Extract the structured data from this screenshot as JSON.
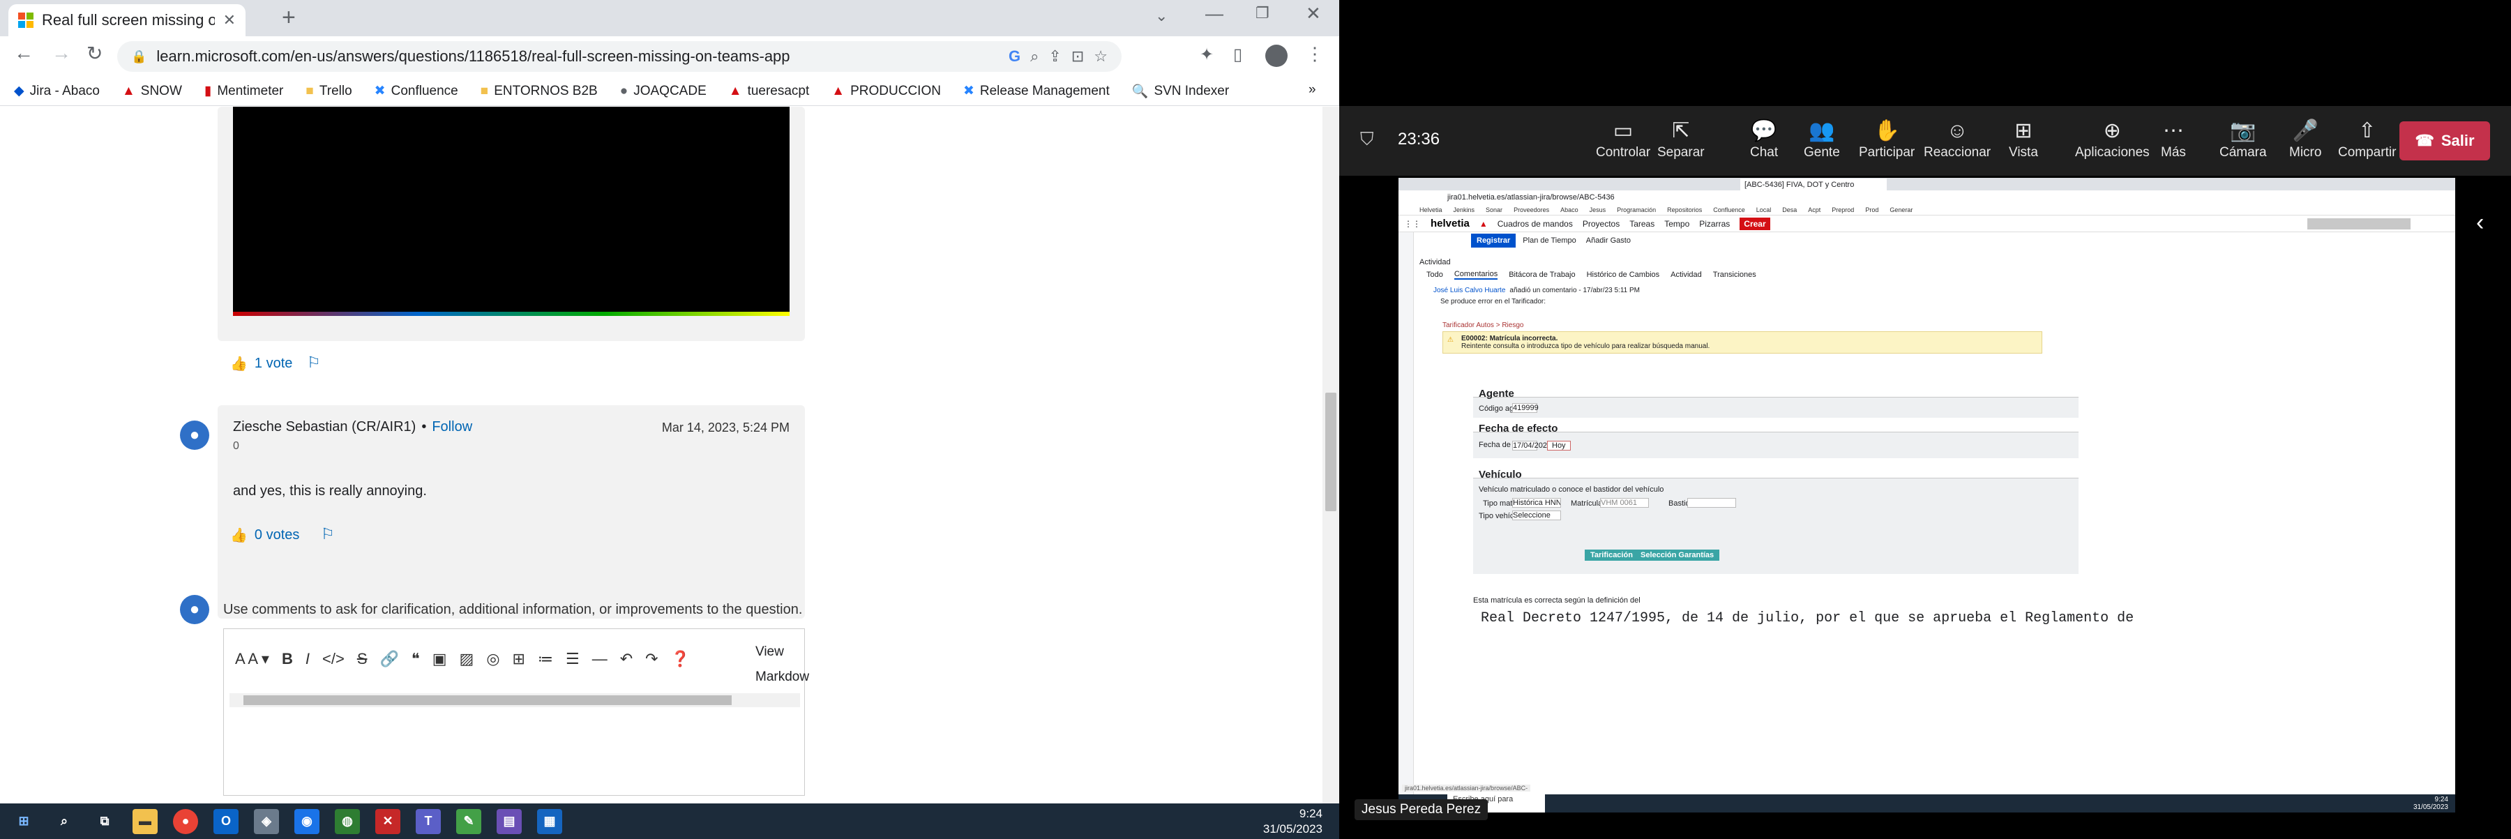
{
  "browser": {
    "tab_title": "Real full screen missing on Teams",
    "url": "learn.microsoft.com/en-us/answers/questions/1186518/real-full-screen-missing-on-teams-app",
    "bookmarks": [
      "Jira - Abaco",
      "SNOW",
      "Mentimeter",
      "Trello",
      "Confluence",
      "ENTORNOS B2B",
      "JOAQCADE",
      "tueresacpt",
      "PRODUCCION",
      "Release Management",
      "SVN Indexer"
    ],
    "more": "»"
  },
  "answer1": {
    "votes": "1 vote"
  },
  "comment": {
    "author": "Ziesche Sebastian (CR/AIR1)",
    "separator": "•",
    "follow": "Follow",
    "rep": "0",
    "date": "Mar 14, 2023, 5:24 PM",
    "text": "and yes, this is really annoying.",
    "votes": "0 votes"
  },
  "comment_box": {
    "prompt": "Use comments to ask for clarification, additional information, or improvements to the question.",
    "view": "View",
    "markdown": "Markdow"
  },
  "taskbar": {
    "time": "9:24",
    "date": "31/05/2023"
  },
  "teams": {
    "timer": "23:36",
    "buttons": [
      "Controlar",
      "Separar",
      "Chat",
      "Gente",
      "Participar",
      "Reaccionar",
      "Vista",
      "Aplicaciones",
      "Más",
      "Cámara",
      "Micro",
      "Compartir"
    ],
    "leave": "Salir",
    "presenter": "Jesus Pereda Perez"
  },
  "shared": {
    "tab": "[ABC-5436] FIVA, DOT y Centro",
    "url": "jira01.helvetia.es/atlassian-jira/browse/ABC-5436",
    "bookmarks": [
      "Helvetia",
      "Jenkins",
      "Sonar",
      "Proveedores",
      "Abaco",
      "Jesus",
      "Programación",
      "Repositorios",
      "Confluence",
      "Local",
      "Desa",
      "Acpt",
      "Preprod",
      "Prod",
      "Generar"
    ],
    "logo": "helvetia",
    "nav": [
      "Cuadros de mandos",
      "Proyectos",
      "Tareas",
      "Tempo",
      "Pizarras"
    ],
    "create": "Crear",
    "tempo_tabs": [
      "Registrar",
      "Plan de Tiempo",
      "Añadir Gasto"
    ],
    "activity": "Actividad",
    "activity_tabs": [
      "Todo",
      "Comentarios",
      "Bitácora de Trabajo",
      "Histórico de Cambios",
      "Actividad",
      "Transiciones"
    ],
    "comment_author": "José Luis Calvo Huarte",
    "comment_meta": "añadió un comentario - 17/abr/23 5:11 PM",
    "comment_text": "Se produce error en el Tarificador:",
    "breadcrumb": "Tarificador Autos > Riesgo",
    "error_title": "E00002: Matrícula incorrecta.",
    "error_text": "Reintente consulta o introduzca tipo de vehículo para realizar búsqueda manual.",
    "agente": "Agente",
    "codigo_label": "Código agente:",
    "codigo_value": "419999",
    "fecha_title": "Fecha de efecto",
    "fecha_label": "Fecha de efecto:",
    "fecha_value": "17/04/2023",
    "hoy": "Hoy",
    "vehiculo": "Vehículo",
    "checkbox_label": "Vehículo matriculado o conoce el bastidor del vehículo",
    "tipo_matricula_label": "Tipo matrícula",
    "tipo_matricula_value": "Histórica HNNNNLLL/VHL",
    "matricula_label": "Matrícula",
    "matricula_value": "VHM 0061",
    "bastidor_label": "Bastidor",
    "tipo_vehiculo_label": "Tipo vehículo:",
    "tipo_vehiculo_value": "Seleccione",
    "btn1": "Tarificación Comparativa",
    "btn2": "Selección Garantías",
    "note": "Esta matrícula es correcta según la definición del",
    "big_text": "Real Decreto 1247/1995, de 14 de julio, por el que se aprueba el Reglamento de",
    "status_url": "jira01.helvetia.es/atlassian-jira/browse/ABC-",
    "search": "Escribe aquí para buscar.",
    "time": "9:24",
    "date": "31/05/2023"
  },
  "colors": {
    "accent": "#0065b3",
    "leave": "#c4314b",
    "jira_red": "#d40f14"
  }
}
